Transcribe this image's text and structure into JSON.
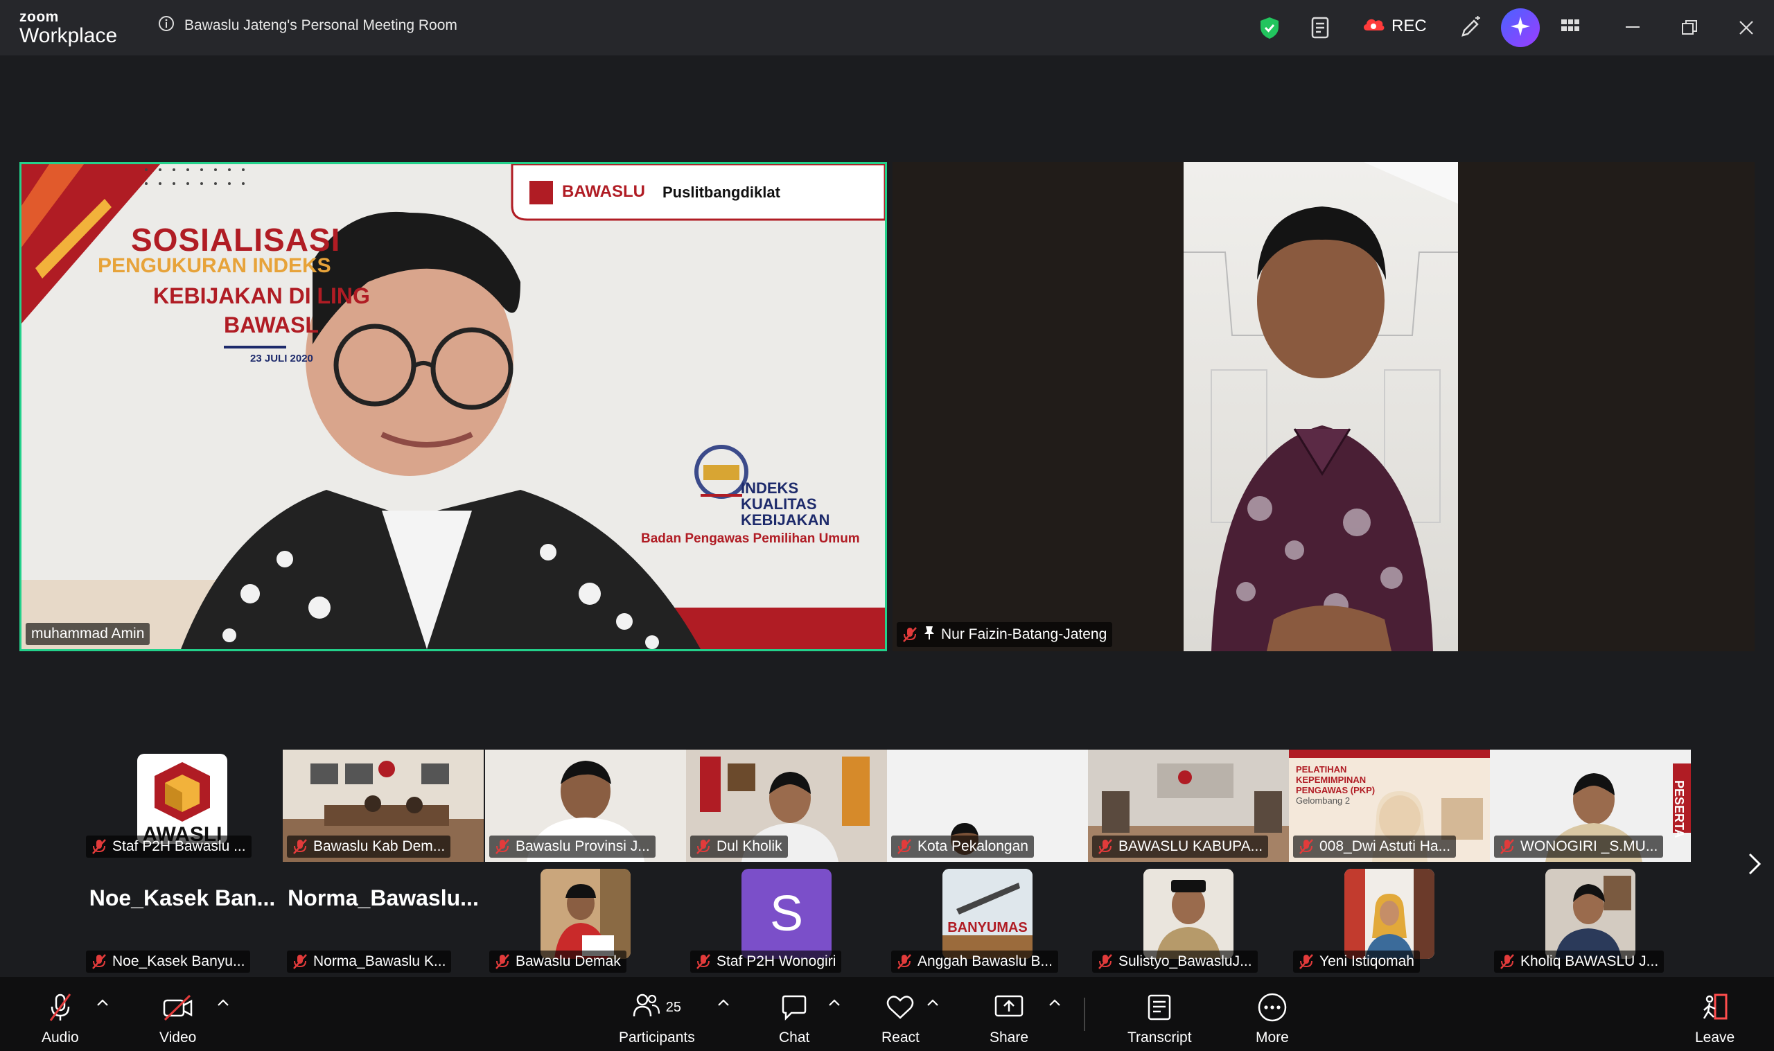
{
  "window": {
    "brand_top": "zoom",
    "brand_bottom": "Workplace",
    "meeting_name": "Bawaslu Jateng's Personal Meeting Room",
    "rec_label": "REC"
  },
  "gallery": {
    "active_speaker": {
      "name": "muhammad Amin",
      "slide": {
        "org": "BAWASLU",
        "org2": "Puslitbangdiklat",
        "title1": "SOSIALISASI",
        "title2": "PENGUKURAN INDEKS",
        "title3": "KEBIJAKAN DI LING",
        "title4": "BAWASL",
        "date": "23 JULI 2020",
        "ikk1": "INDEKS",
        "ikk2": "KUALITAS",
        "ikk3": "KEBIJAKAN",
        "ikk4": "Badan Pengawas Pemilihan Umum"
      }
    },
    "pinned": {
      "name": "Nur Faizin-Batang-Jateng"
    },
    "row1": [
      {
        "name": "Staf P2H Bawaslu ...",
        "logo_text": "AWASLI"
      },
      {
        "name": "Bawaslu Kab Dem..."
      },
      {
        "name": "Bawaslu Provinsi J..."
      },
      {
        "name": "Dul Kholik"
      },
      {
        "name": "Kota Pekalongan"
      },
      {
        "name": "BAWASLU KABUPA..."
      },
      {
        "name": "008_Dwi Astuti Ha...",
        "banner1": "PELATIHAN",
        "banner2": "KEPEMIMPINAN",
        "banner3": "PENGAWAS (PKP)",
        "banner4": "Gelombang 2"
      },
      {
        "name": "WONOGIRI _S.MU...",
        "side": "PESERTA"
      }
    ],
    "row2": [
      {
        "name": "Noe_Kasek  Banyu...",
        "big": "Noe_Kasek   Ban..."
      },
      {
        "name": "Norma_Bawaslu K...",
        "big": "Norma_Bawaslu..."
      },
      {
        "name": "Bawaslu Demak"
      },
      {
        "name": "Staf P2H Wonogiri",
        "letter": "S"
      },
      {
        "name": "Anggah Bawaslu B...",
        "sign": "BANYUMAS"
      },
      {
        "name": "Sulistyo_BawasluJ..."
      },
      {
        "name": "Yeni Istiqomah"
      },
      {
        "name": "Kholiq BAWASLU J..."
      }
    ]
  },
  "toolbar": {
    "audio": "Audio",
    "video": "Video",
    "participants": "Participants",
    "participants_count": "25",
    "chat": "Chat",
    "react": "React",
    "share": "Share",
    "transcript": "Transcript",
    "more": "More",
    "leave": "Leave"
  },
  "colors": {
    "active_border": "#23d18b",
    "ai_button": "#5b4dff",
    "leave": "#ff4d4d",
    "security": "#22c55e"
  }
}
